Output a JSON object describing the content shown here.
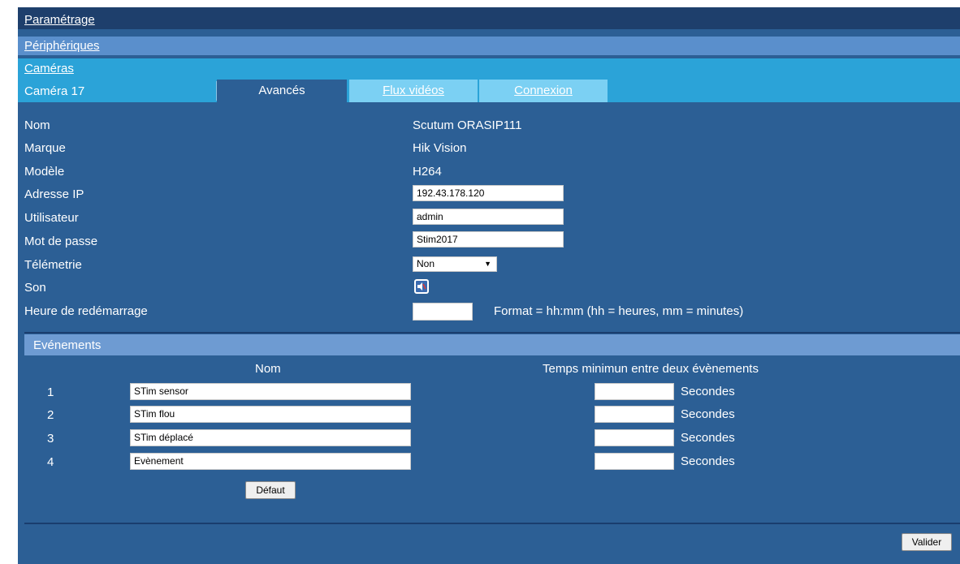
{
  "nav": {
    "level1": "Paramétrage",
    "level2": "Périphériques",
    "level3": "Caméras"
  },
  "camera": {
    "title": "Caméra 17",
    "tabs": [
      {
        "label": "Avancés",
        "active": true
      },
      {
        "label": "Flux vidéos",
        "active": false
      },
      {
        "label": "Connexion",
        "active": false
      }
    ]
  },
  "form": {
    "nom_label": "Nom",
    "nom_value": "Scutum ORASIP111",
    "marque_label": "Marque",
    "marque_value": "Hik Vision",
    "modele_label": "Modèle",
    "modele_value": "H264",
    "ip_label": "Adresse IP",
    "ip_value": "192.43.178.120",
    "user_label": "Utilisateur",
    "user_value": "admin",
    "pass_label": "Mot de passe",
    "pass_value": "Stim2017",
    "telemetrie_label": "Télémetrie",
    "telemetrie_value": "Non",
    "son_label": "Son",
    "son_icon": "speaker-muted-icon",
    "reboot_label": "Heure de redémarrage",
    "reboot_value": "",
    "reboot_format": "Format = hh:mm  (hh = heures, mm = minutes)"
  },
  "events": {
    "section_title": "Evénements",
    "col_name": "Nom",
    "col_time": "Temps minimun entre deux évènements",
    "unit": "Secondes",
    "rows": [
      {
        "num": "1",
        "name": "STim sensor",
        "seconds": ""
      },
      {
        "num": "2",
        "name": "STim flou",
        "seconds": ""
      },
      {
        "num": "3",
        "name": "STim déplacé",
        "seconds": ""
      },
      {
        "num": "4",
        "name": "Evènement",
        "seconds": ""
      }
    ],
    "default_button": "Défaut"
  },
  "footer": {
    "submit_button": "Valider"
  },
  "colors": {
    "panel": "#2c5f95",
    "nav_dark": "#1e3f6c",
    "nav_mid": "#5a8fcc",
    "nav_light": "#2ba3d8",
    "tab_inactive": "#7bd0f3",
    "section_bar": "#6e9bd2"
  }
}
